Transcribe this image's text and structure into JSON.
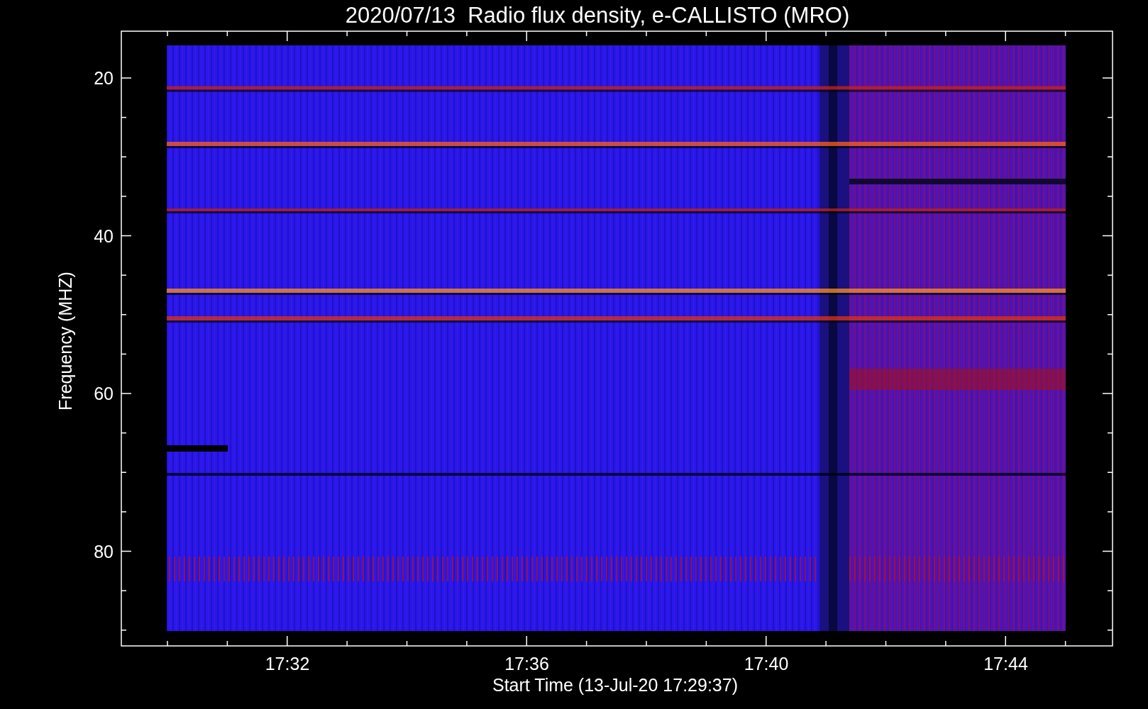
{
  "title": "2020/07/13  Radio flux density, e-CALLISTO (MRO)",
  "y_axis": {
    "label": "Frequency (MHZ)",
    "ticks": [
      "20",
      "40",
      "60",
      "80"
    ]
  },
  "x_axis": {
    "label": "Start Time (13-Jul-20 17:29:37)",
    "ticks": [
      "17:32",
      "17:36",
      "17:40",
      "17:44"
    ]
  }
}
